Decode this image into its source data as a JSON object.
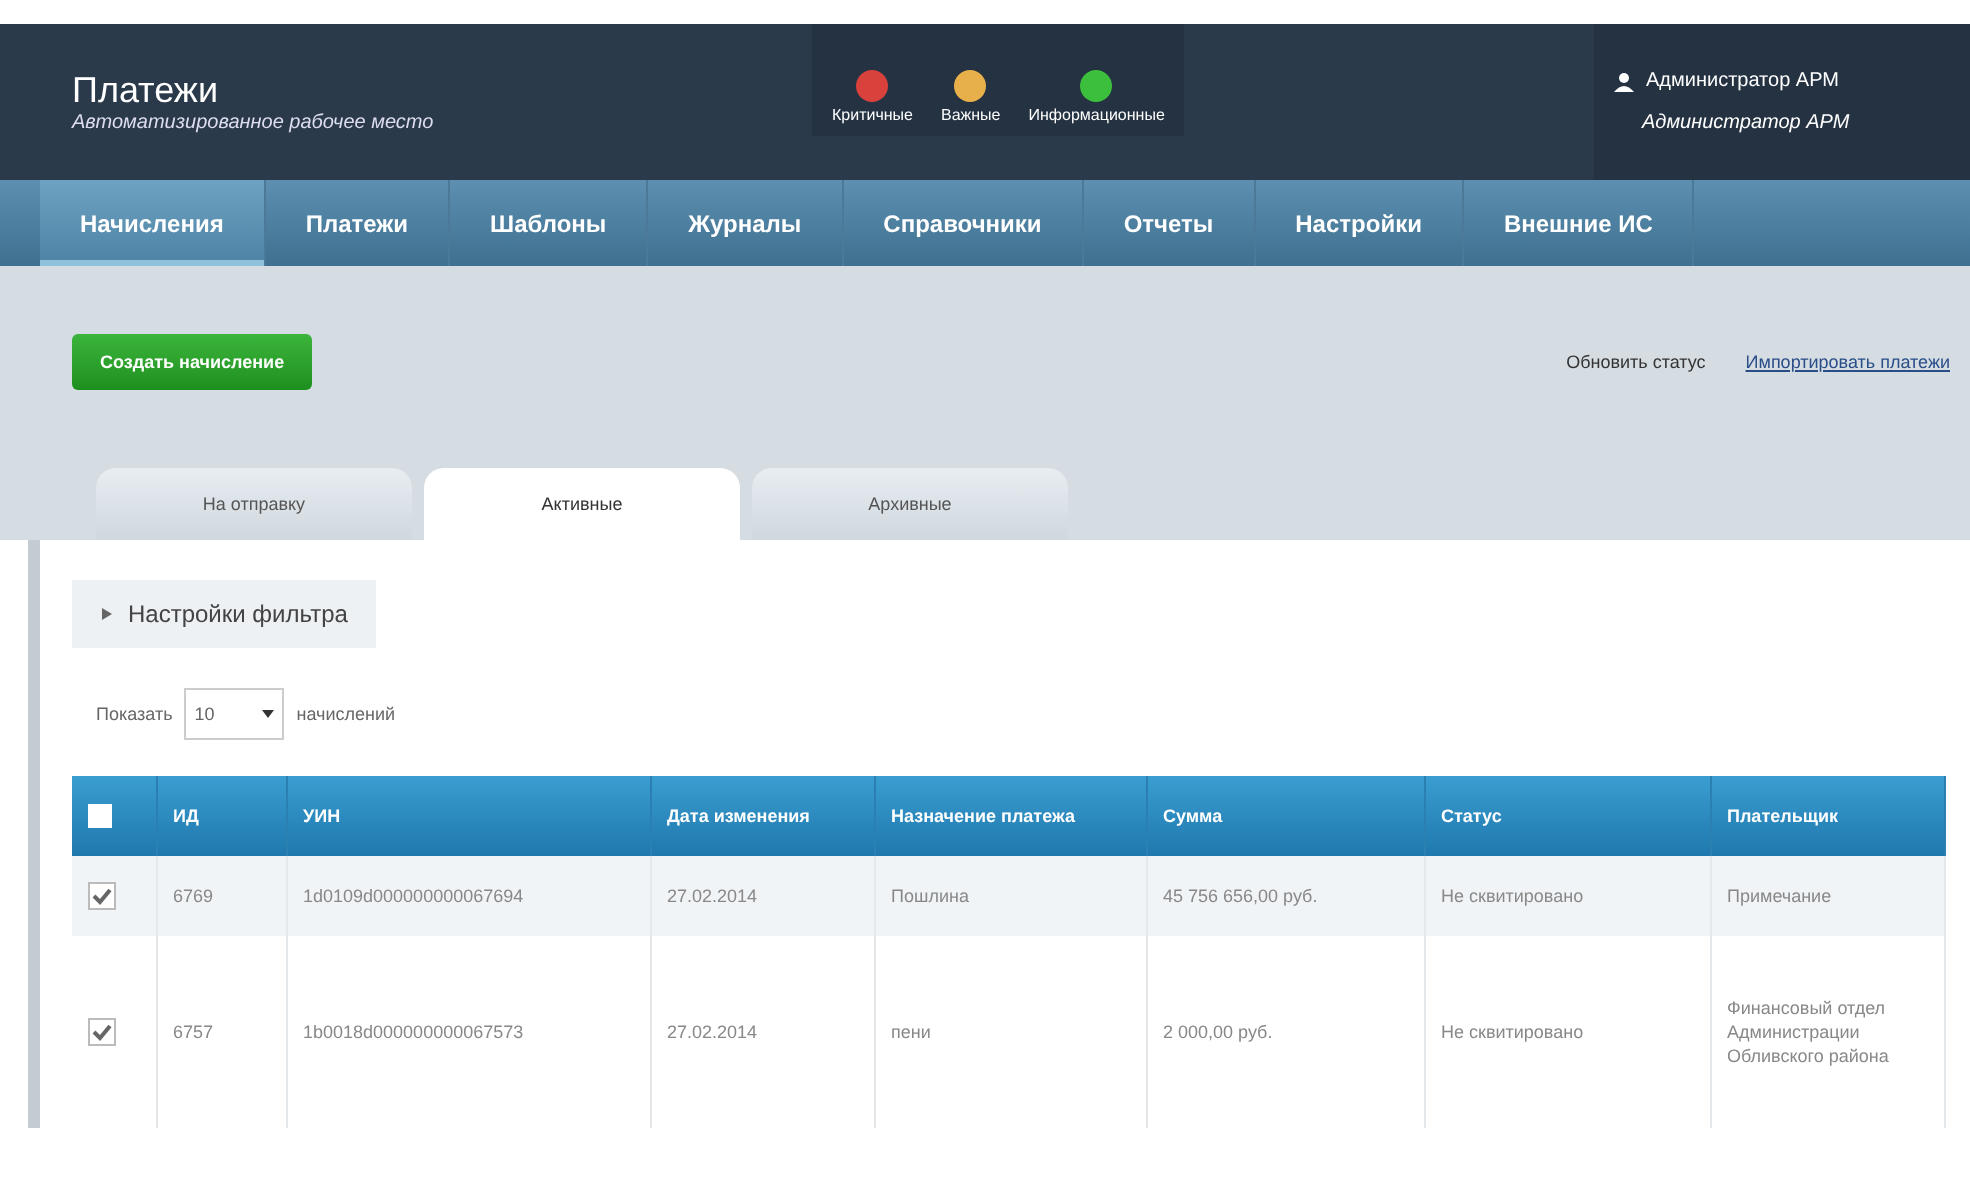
{
  "header": {
    "title": "Платежи",
    "subtitle": "Автоматизированное рабочее место",
    "alerts": [
      {
        "label": "Критичные",
        "color": "#d9413c"
      },
      {
        "label": "Важные",
        "color": "#e8b04a"
      },
      {
        "label": "Информационные",
        "color": "#3cbf3c"
      }
    ],
    "user": {
      "name": "Администратор АРМ",
      "role": "Администратор АРМ"
    }
  },
  "nav": [
    {
      "label": "Начисления",
      "selected": true
    },
    {
      "label": "Платежи",
      "selected": false
    },
    {
      "label": "Шаблоны",
      "selected": false
    },
    {
      "label": "Журналы",
      "selected": false
    },
    {
      "label": "Справочники",
      "selected": false
    },
    {
      "label": "Отчеты",
      "selected": false
    },
    {
      "label": "Настройки",
      "selected": false
    },
    {
      "label": "Внешние ИС",
      "selected": false
    }
  ],
  "create_button": "Создать начисление",
  "links": [
    "Обновить статус",
    "Импортировать платежи"
  ],
  "tabs": [
    {
      "label": "На отправку",
      "selected": false
    },
    {
      "label": "Активные",
      "selected": true
    },
    {
      "label": "Архивные",
      "selected": false
    }
  ],
  "filter": {
    "label": "Настройки фильтра",
    "expanded": false
  },
  "page_size": {
    "prefix": "Показать",
    "value": "10",
    "suffix": "начислений"
  },
  "table": {
    "select_all": {
      "checked": false
    },
    "columns": [
      "ИД",
      "УИН",
      "Дата изменения",
      "Назначение платежа",
      "Сумма",
      "Статус",
      "Плательщик"
    ],
    "rows": [
      {
        "checked": true,
        "cells": [
          "6769",
          "1d0109d000000000067694",
          "27.02.2014",
          "Пошлина",
          "45 756 656,00 руб.",
          "Не сквитировано",
          "Примечание"
        ]
      },
      {
        "checked": true,
        "cells": [
          "6757",
          "1b0018d000000000067573",
          "27.02.2014",
          "пени",
          "2 000,00 руб.",
          "Не сквитировано",
          "Финансовый отдел Администрации Обливского района"
        ]
      }
    ]
  }
}
